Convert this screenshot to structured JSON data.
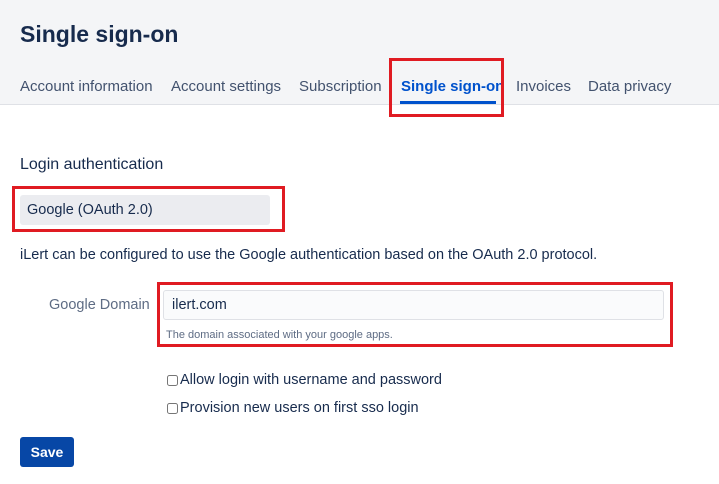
{
  "page": {
    "title": "Single sign-on"
  },
  "tabs": [
    {
      "label": "Account information",
      "active": false
    },
    {
      "label": "Account settings",
      "active": false
    },
    {
      "label": "Subscription",
      "active": false
    },
    {
      "label": "Single sign-on",
      "active": true
    },
    {
      "label": "Invoices",
      "active": false
    },
    {
      "label": "Data privacy",
      "active": false
    }
  ],
  "login": {
    "section_title": "Login authentication",
    "provider_selected": "Google (OAuth 2.0)",
    "description": "iLert can be configured to use the Google authentication based on the OAuth 2.0 protocol."
  },
  "google_domain": {
    "label": "Google Domain",
    "value": "ilert.com",
    "help": "The domain associated with your google apps."
  },
  "options": [
    {
      "label": "Allow login with username and password",
      "checked": false
    },
    {
      "label": "Provision new users on first sso login",
      "checked": false
    }
  ],
  "actions": {
    "save_label": "Save"
  },
  "colors": {
    "accent": "#0052cc",
    "button": "#0747a6",
    "highlight": "#e01b22",
    "header_bg": "#f4f5f7"
  }
}
